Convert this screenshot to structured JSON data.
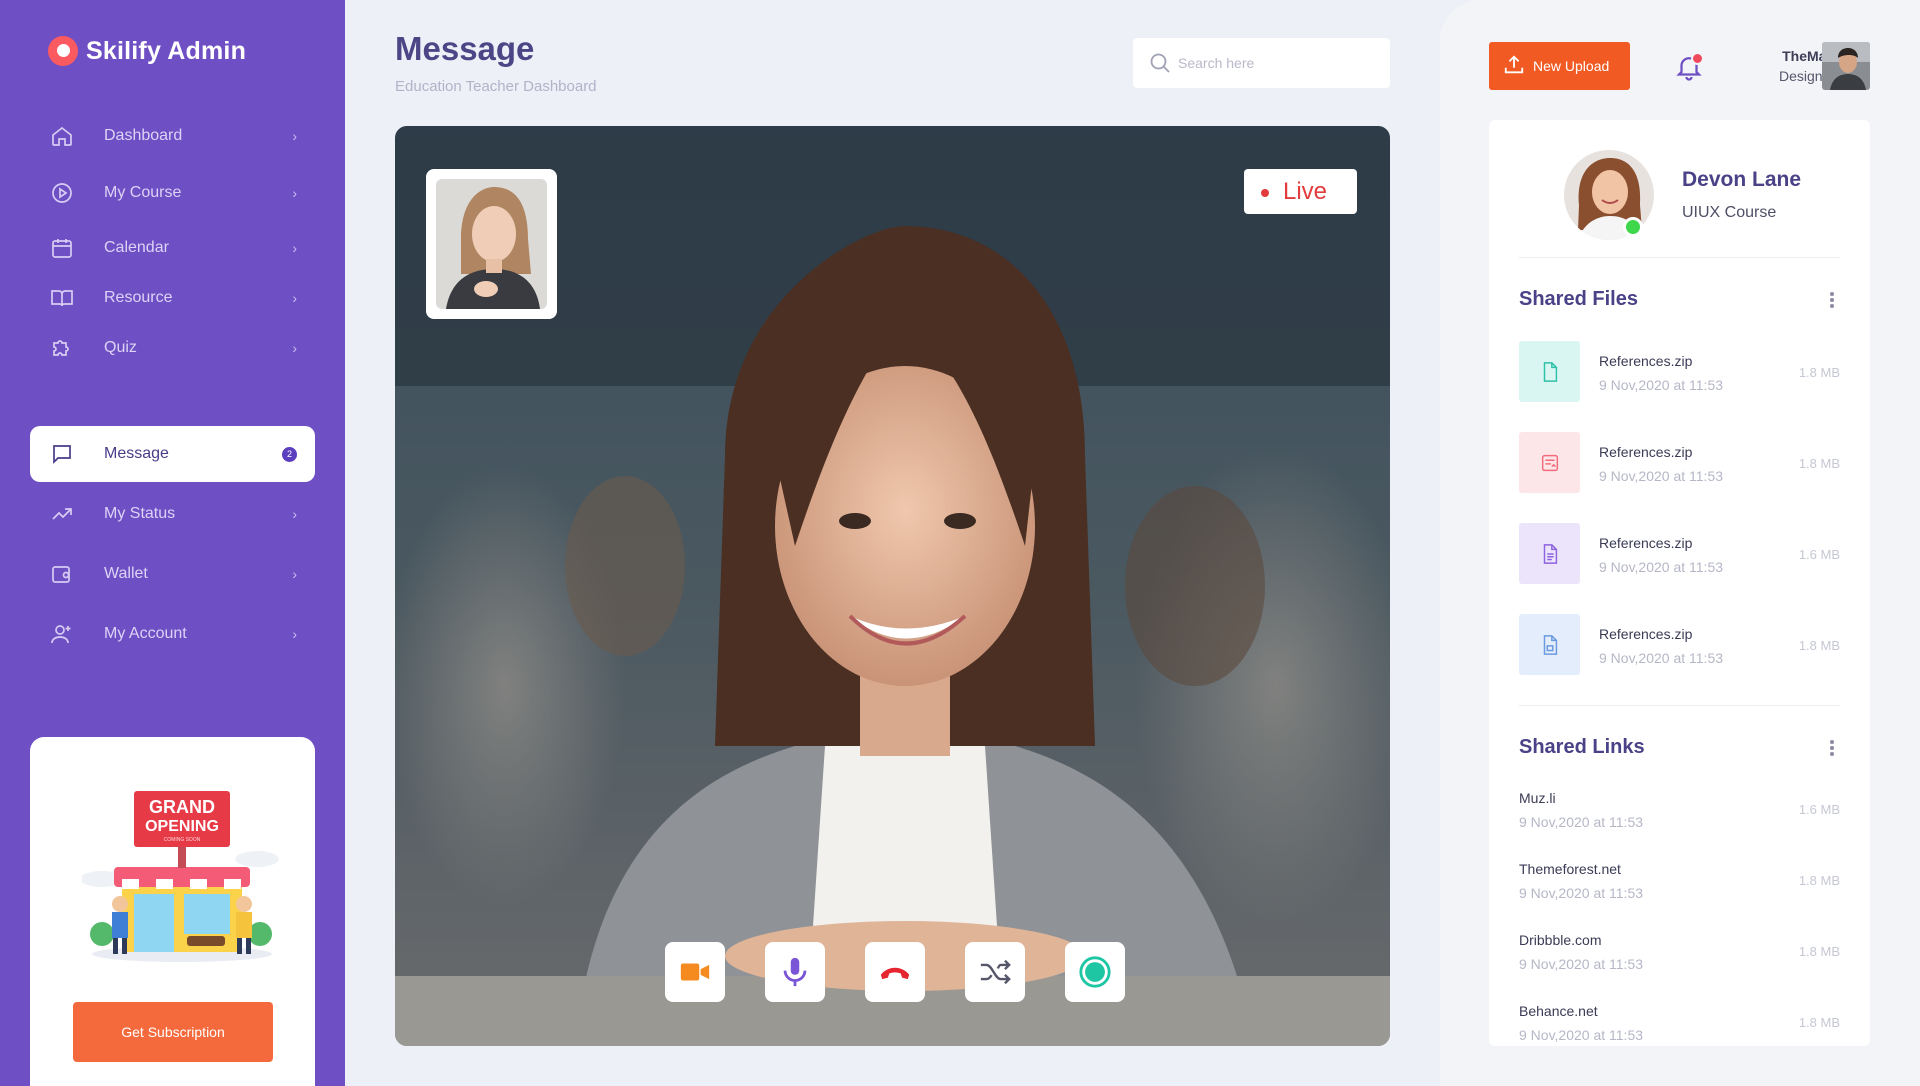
{
  "app": {
    "name": "Skilify Admin"
  },
  "sidebar": {
    "items": [
      {
        "label": "Dashboard",
        "icon": "home-icon",
        "active": false
      },
      {
        "label": "My Course",
        "icon": "play-circle-icon",
        "active": false
      },
      {
        "label": "Calendar",
        "icon": "calendar-icon",
        "active": false
      },
      {
        "label": "Resource",
        "icon": "book-icon",
        "active": false
      },
      {
        "label": "Quiz",
        "icon": "puzzle-icon",
        "active": false
      },
      {
        "label": "Message",
        "icon": "chat-icon",
        "active": true,
        "badge": "2"
      },
      {
        "label": "My Status",
        "icon": "trending-up-icon",
        "active": false
      },
      {
        "label": "Wallet",
        "icon": "wallet-icon",
        "active": false
      },
      {
        "label": "My Account",
        "icon": "user-icon",
        "active": false
      }
    ],
    "promo": {
      "sign_line1": "GRAND",
      "sign_line2": "OPENING",
      "sign_line3": "COMING SOON",
      "button_label": "Get Subscription"
    }
  },
  "header": {
    "title": "Message",
    "subtitle": "Education Teacher Dashboard",
    "search_placeholder": "Search here"
  },
  "video": {
    "live_label": "Live",
    "controls": [
      "video-camera-icon",
      "microphone-icon",
      "hang-up-icon",
      "shuffle-icon",
      "record-icon"
    ]
  },
  "topbar": {
    "upload_label": "New Upload",
    "user_name": "TheMad",
    "user_role": "Designer"
  },
  "profile": {
    "name": "Devon Lane",
    "course": "UIUX Course"
  },
  "shared_files": {
    "title": "Shared Files",
    "items": [
      {
        "name": "References.zip",
        "date": "9 Nov,2020 at 11:53",
        "size": "1.8 MB",
        "icon": "document-icon"
      },
      {
        "name": "References.zip",
        "date": "9 Nov,2020 at 11:53",
        "size": "1.8 MB",
        "icon": "image-file-icon"
      },
      {
        "name": "References.zip",
        "date": "9 Nov,2020 at 11:53",
        "size": "1.6 MB",
        "icon": "text-file-icon"
      },
      {
        "name": "References.zip",
        "date": "9 Nov,2020 at 11:53",
        "size": "1.8 MB",
        "icon": "archive-file-icon"
      }
    ]
  },
  "shared_links": {
    "title": "Shared Links",
    "items": [
      {
        "name": "Muz.li",
        "date": "9 Nov,2020 at 11:53",
        "size": "1.6 MB"
      },
      {
        "name": "Themeforest.net",
        "date": "9 Nov,2020 at 11:53",
        "size": "1.8 MB"
      },
      {
        "name": "Dribbble.com",
        "date": "9 Nov,2020 at 11:53",
        "size": "1.8 MB"
      },
      {
        "name": "Behance.net",
        "date": "9 Nov,2020 at 11:53",
        "size": "1.8 MB"
      }
    ]
  },
  "colors": {
    "sidebar": "#6f4fc4",
    "accent_orange": "#f15a22",
    "title_purple": "#4d4586",
    "live_red": "#e23b3b",
    "online_green": "#3ed64a"
  }
}
